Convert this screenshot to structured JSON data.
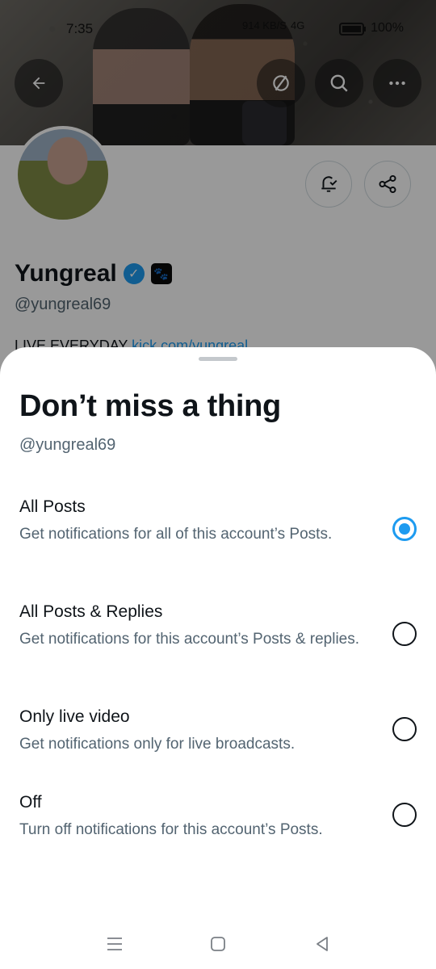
{
  "status_bar": {
    "time": "7:35",
    "network_speed": "914 KB/S",
    "signal": "4G",
    "battery": "100%"
  },
  "banner_buttons": {
    "back_icon": "arrow-left-icon",
    "grok_icon": "slash-circle-icon",
    "search_icon": "search-icon",
    "more_icon": "ellipsis-icon"
  },
  "profile": {
    "name": "Yungreal",
    "handle": "@yungreal69",
    "bio_prefix": "LIVE EVERYDAY",
    "bio_link": "kick.com/yungreal",
    "notify_icon": "bell-check-icon",
    "share_icon": "share-icon"
  },
  "sheet": {
    "title": "Don’t miss a thing",
    "handle": "@yungreal69",
    "options": [
      {
        "label": "All Posts",
        "description": "Get notifications for all of this account’s Posts.",
        "selected": true
      },
      {
        "label": "All Posts & Replies",
        "description": "Get notifications for this account’s Posts & replies.",
        "selected": false
      },
      {
        "label": "Only live video",
        "description": "Get notifications only for live broadcasts.",
        "selected": false
      },
      {
        "label": "Off",
        "description": "Turn off notifications for this account’s Posts.",
        "selected": false
      }
    ]
  },
  "nav": {
    "menu_icon": "menu-icon",
    "home_icon": "home-square-icon",
    "back_icon": "back-triangle-icon"
  },
  "colors": {
    "accent": "#1d9bf0",
    "text_primary": "#0f1419",
    "text_secondary": "#536471"
  }
}
